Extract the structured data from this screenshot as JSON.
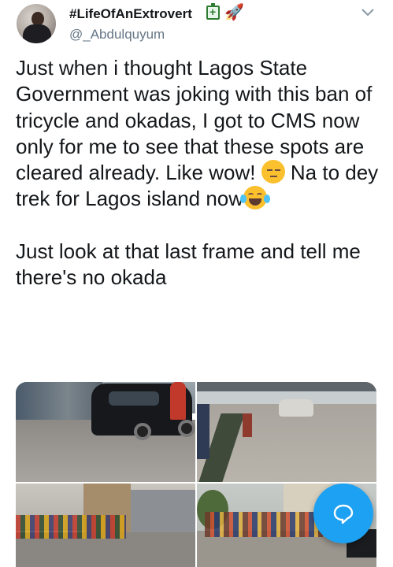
{
  "user": {
    "display_name": "#LifeOfAnExtrovert",
    "handle": "@_Abdulquyum",
    "badge_icons": [
      "battery-icon",
      "rocket-icon"
    ]
  },
  "tweet": {
    "para1_line1": "Just when i thought Lagos State Government was joking with this ban of tricycle and okadas, I got to CMS now only for me to see that these spots are cleared already. Like wow! ",
    "para1_line2": " Na to dey trek for Lagos island now",
    "para2": "Just look at that last frame and tell me there's no okada"
  },
  "media": {
    "photo_count": 4
  },
  "colors": {
    "accent": "#1da1f2",
    "text": "#14171a",
    "secondary": "#657786"
  },
  "icons": {
    "menu": "chevron-down-icon",
    "fab": "chat-bubble-icon"
  }
}
